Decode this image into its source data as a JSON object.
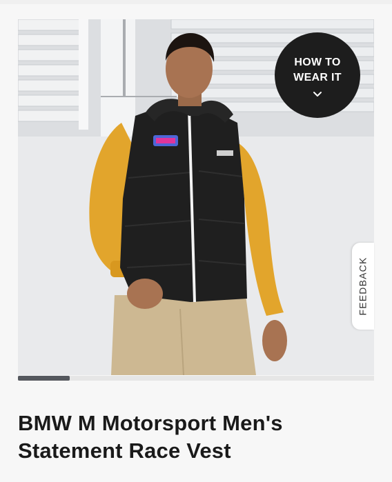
{
  "product": {
    "title": "BMW M Motorsport Men's Statement Race Vest"
  },
  "gallery": {
    "how_to_wear_label": "HOW TO WEAR IT",
    "feedback_label": "FEEDBACK",
    "scroll_progress_fraction": 0.145
  },
  "colors": {
    "badge_bg": "#1d1d1d",
    "vest": "#1f1f1f",
    "shirt": "#e2a52c",
    "pants": "#cdb892",
    "progress_fill": "#55585e"
  },
  "icons": {
    "how_to_wear_chevron": "chevron-down-icon"
  }
}
